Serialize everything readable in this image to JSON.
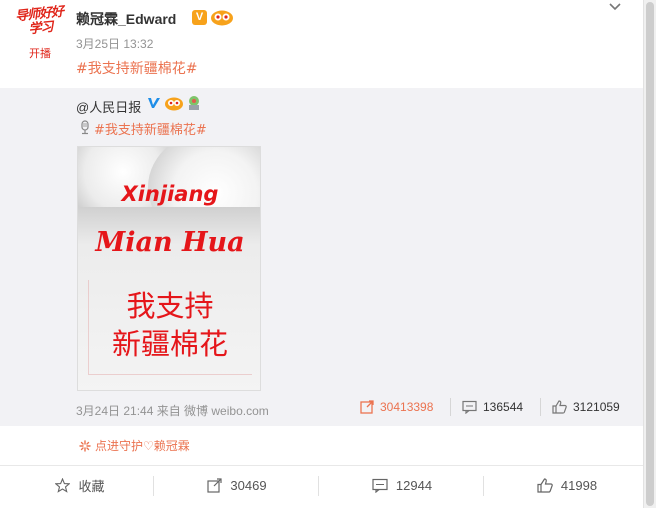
{
  "post": {
    "avatar_text": "导师好好学习",
    "avatar_live": "开播",
    "username": "赖冠霖_Edward",
    "verified_badge": "V",
    "time": "3月25日 13:32",
    "hashtag": "#我支持新疆棉花#"
  },
  "forwarded": {
    "user": "@人民日报",
    "hashtag": "#我支持新疆棉花#",
    "image": {
      "line1": "Xinjiang",
      "line2": "Mian Hua",
      "line3": "我支持",
      "line4": "新疆棉花"
    },
    "meta": "3月24日 21:44 来自 微博 weibo.com",
    "reposts": "30413398",
    "comments": "136544",
    "likes": "3121059"
  },
  "guard_text": "点进守护♡赖冠霖",
  "footer": {
    "collect": "收藏",
    "reposts": "30469",
    "comments": "12944",
    "likes": "41998"
  },
  "colors": {
    "accent": "#eb7350",
    "brand_red": "#e5161a",
    "verified_orange": "#f7a21b",
    "verified_blue": "#1f8ee8",
    "forward_bg": "#f2f2f5"
  },
  "icons": {
    "verified": "verified-v-icon",
    "level": "vip-level-icon",
    "mic": "microphone-icon",
    "repost": "repost-icon",
    "comment": "comment-icon",
    "like": "thumbs-up-icon",
    "star": "star-icon",
    "guard": "sparkle-icon",
    "menu": "chevron-down-icon"
  }
}
